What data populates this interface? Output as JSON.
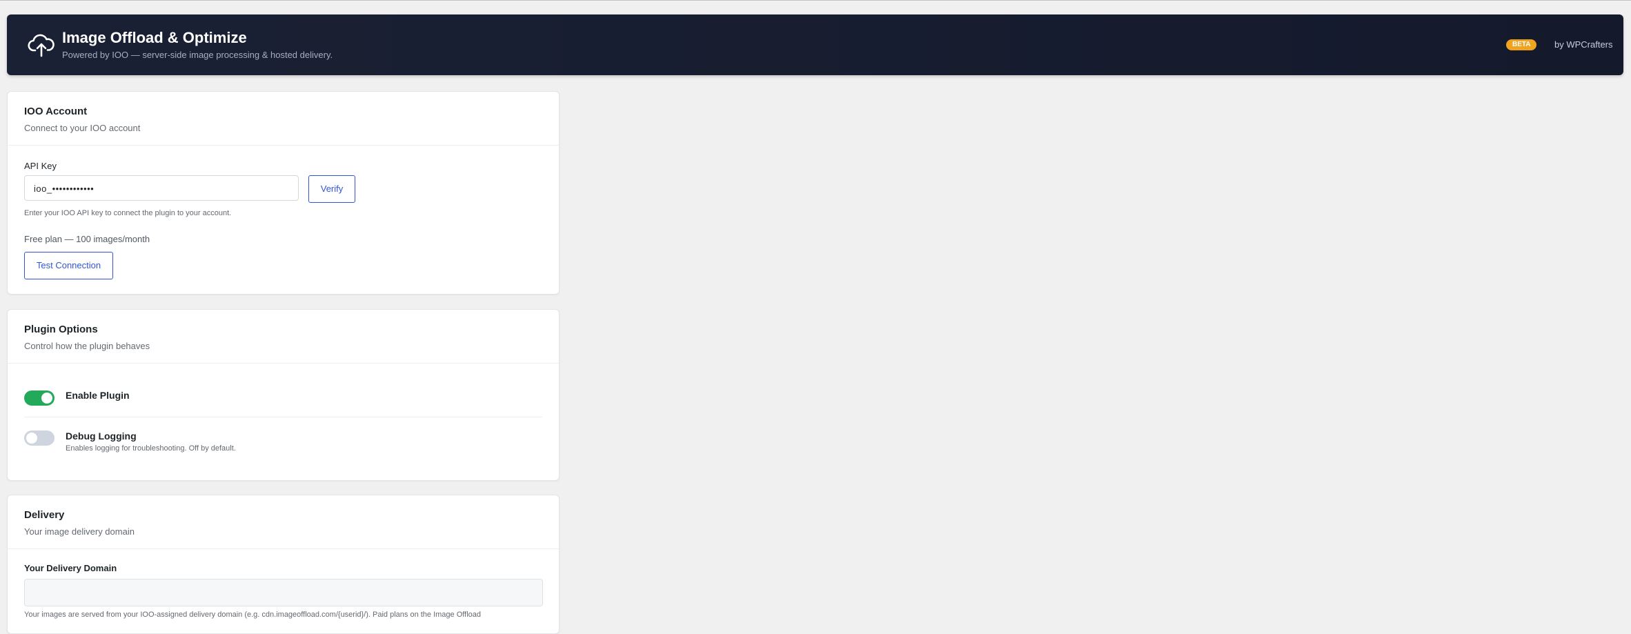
{
  "header": {
    "title": "Image Offload & Optimize",
    "subtitle": "Powered by IOO — server-side image processing & hosted delivery.",
    "badge": "BETA",
    "byline": "by WPCrafters",
    "icon": "cloud-upload-icon"
  },
  "account": {
    "title": "IOO Account",
    "subtitle": "Connect to your IOO account",
    "api_key_label": "API Key",
    "api_key_value": "ioo_••••••••••••",
    "verify_label": "Verify",
    "help": "Enter your IOO API key to connect the plugin to your account.",
    "plan": "Free plan — 100 images/month",
    "test_label": "Test Connection"
  },
  "options": {
    "title": "Plugin Options",
    "subtitle": "Control how the plugin behaves",
    "enable_label": "Enable Plugin",
    "enable_on": true,
    "debug_label": "Debug Logging",
    "debug_desc": "Enables logging for troubleshooting. Off by default.",
    "debug_on": false
  },
  "delivery": {
    "title": "Delivery",
    "subtitle": "Your image delivery domain",
    "domain_label": "Your Delivery Domain",
    "domain_value": "",
    "help": "Your images are served from your IOO-assigned delivery domain (e.g. cdn.imageoffload.com/{userid}/). Paid plans on the Image Offload"
  },
  "colors": {
    "header_bg": "#1b2134",
    "badge": "#f0a31f",
    "accent": "#2f54d8",
    "toggle_on": "#22a95a",
    "toggle_off": "#cfd5de"
  }
}
